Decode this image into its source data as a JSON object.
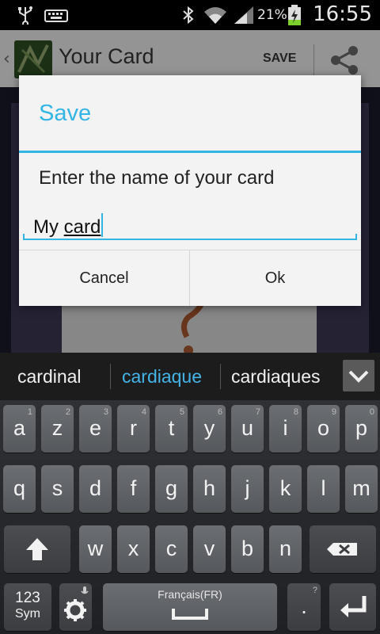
{
  "status_bar": {
    "time": "16:55",
    "battery_percent": "21%",
    "icons": [
      "usb-icon",
      "keyboard-icon",
      "bluetooth-icon",
      "wifi-icon",
      "signal-icon",
      "battery-charging-icon"
    ]
  },
  "action_bar": {
    "title": "Your Card",
    "save_label": "SAVE",
    "share_icon": "share-icon"
  },
  "dialog": {
    "title": "Save",
    "message": "Enter the name of your card",
    "input_prefix": "My ",
    "input_word": "card",
    "cancel_label": "Cancel",
    "ok_label": "Ok"
  },
  "suggestions": {
    "items": [
      "cardinal",
      "cardiaque",
      "cardiaques"
    ],
    "selected_index": 1
  },
  "keyboard": {
    "row1": [
      {
        "key": "a",
        "hint": "1"
      },
      {
        "key": "z",
        "hint": "2"
      },
      {
        "key": "e",
        "hint": "3"
      },
      {
        "key": "r",
        "hint": "4"
      },
      {
        "key": "t",
        "hint": "5"
      },
      {
        "key": "y",
        "hint": "6"
      },
      {
        "key": "u",
        "hint": "7"
      },
      {
        "key": "i",
        "hint": "8"
      },
      {
        "key": "o",
        "hint": "9"
      },
      {
        "key": "p",
        "hint": "0"
      }
    ],
    "row2": [
      "q",
      "s",
      "d",
      "f",
      "g",
      "h",
      "j",
      "k",
      "l",
      "m"
    ],
    "row3": [
      "w",
      "x",
      "c",
      "v",
      "b",
      "n"
    ],
    "sym_label_top": "123",
    "sym_label_bottom": "Sym",
    "space_label": "Français(FR)",
    "period_label": ".",
    "period_hint": "?",
    "colors": {
      "accent": "#33b5e5",
      "suggest_selected": "#44b4e8"
    }
  }
}
